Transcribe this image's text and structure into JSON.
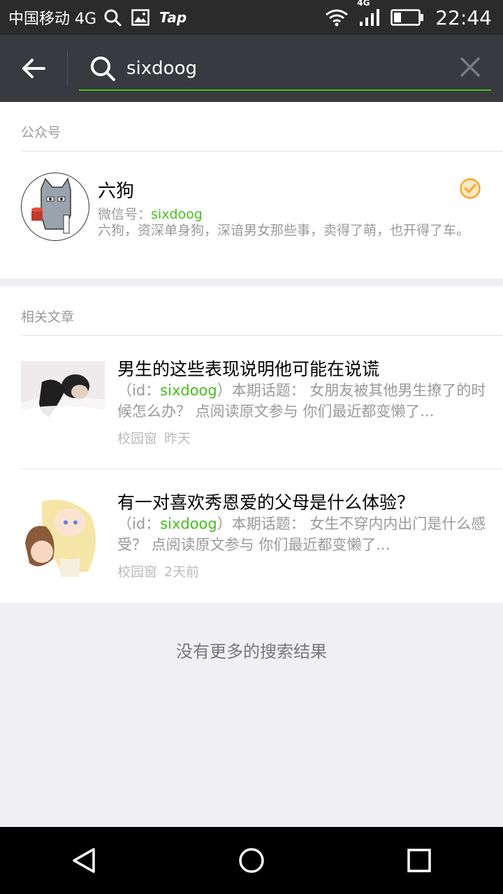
{
  "status_bar": {
    "carrier": "中国移动 4G",
    "app_label": "Tap",
    "network_badge": "4G",
    "time": "22:44"
  },
  "search": {
    "query": "sixdoog",
    "placeholder": ""
  },
  "accounts_section": {
    "title": "公众号",
    "account": {
      "name": "六狗",
      "id_label": "微信号：",
      "id_value": "sixdoog",
      "description": "六狗，资深单身狗，深谙男女那些事，卖得了萌，也开得了车。"
    }
  },
  "articles_section": {
    "title": "相关文章",
    "items": [
      {
        "title": "男生的这些表现说明他可能在说谎",
        "desc_prefix": "（id：",
        "desc_id": "sixdoog",
        "desc_rest": "）本期话题： 女朋友被其他男生撩了的时候怎么办？ 点阅读原文参与 你们最近都变懒了...",
        "source": "校园窗",
        "time": "昨天"
      },
      {
        "title": "有一对喜欢秀恩爱的父母是什么体验？",
        "desc_prefix": "（id：",
        "desc_id": "sixdoog",
        "desc_rest": "）本期话题： 女生不穿内内出门是什么感受？ 点阅读原文参与 你们最近都变懒了...",
        "source": "校园窗",
        "time": "2天前"
      }
    ]
  },
  "footer": {
    "no_more": "没有更多的搜索结果"
  },
  "colors": {
    "accent_green": "#45c01a",
    "header_bg": "#393a3f",
    "verified_orange": "#f7a52b"
  }
}
